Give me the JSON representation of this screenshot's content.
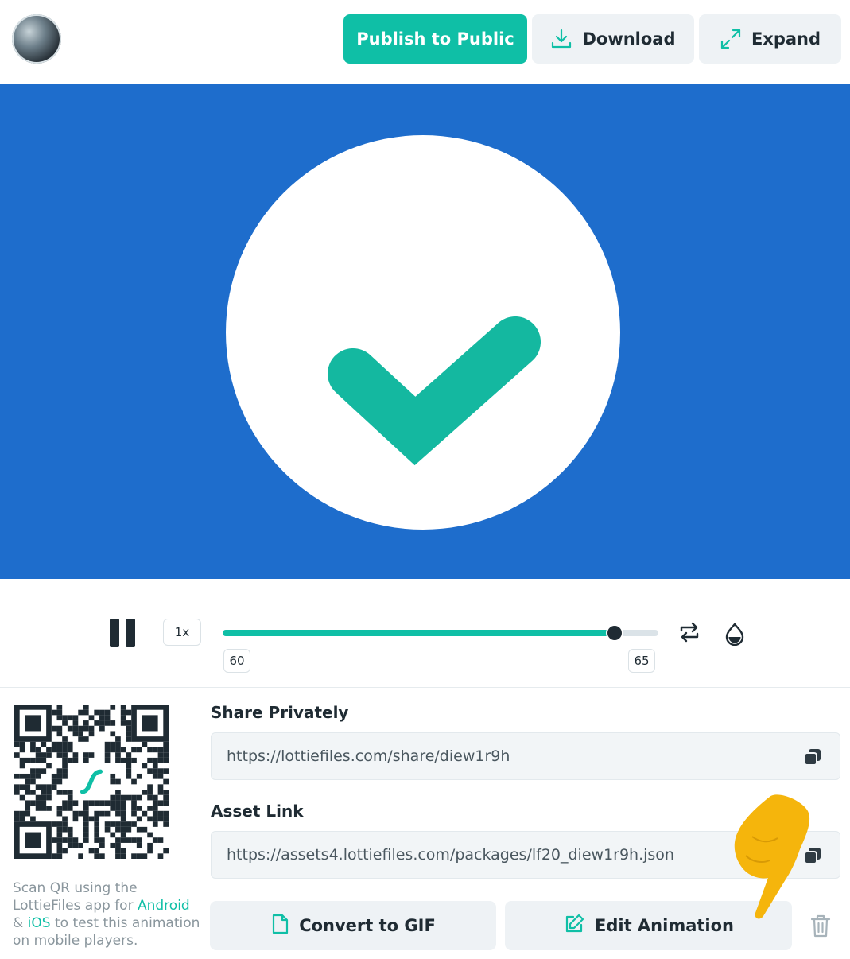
{
  "header": {
    "publish_label": "Publish to Public",
    "download_label": "Download",
    "expand_label": "Expand",
    "icons": [
      "download-icon",
      "expand-icon"
    ]
  },
  "colors": {
    "accent": "#0fbfa6",
    "stage_background": "#1e6dcc",
    "button_background": "#eef2f5",
    "text_dark": "#1f2b33",
    "pointer": "#f5b50c"
  },
  "player": {
    "speed": "1x",
    "frame_start": "60",
    "frame_end": "65",
    "progress": 0.9,
    "icons": [
      "pause-icon",
      "loop-icon",
      "background-color-icon"
    ]
  },
  "qr": {
    "caption_1": "Scan QR using the LottieFiles app for ",
    "android": "Android",
    "caption_2": "& ",
    "ios": "iOS",
    "caption_3": " to test this animation on mobile players."
  },
  "share": {
    "label": "Share Privately",
    "url": "https://lottiefiles.com/share/diew1r9h"
  },
  "asset": {
    "label": "Asset Link",
    "url": "https://assets4.lottiefiles.com/packages/lf20_diew1r9h.json"
  },
  "actions": {
    "gif_label": "Convert to GIF",
    "edit_label": "Edit Animation",
    "icons": [
      "file-icon",
      "edit-icon",
      "trash-icon",
      "copy-icon"
    ]
  }
}
